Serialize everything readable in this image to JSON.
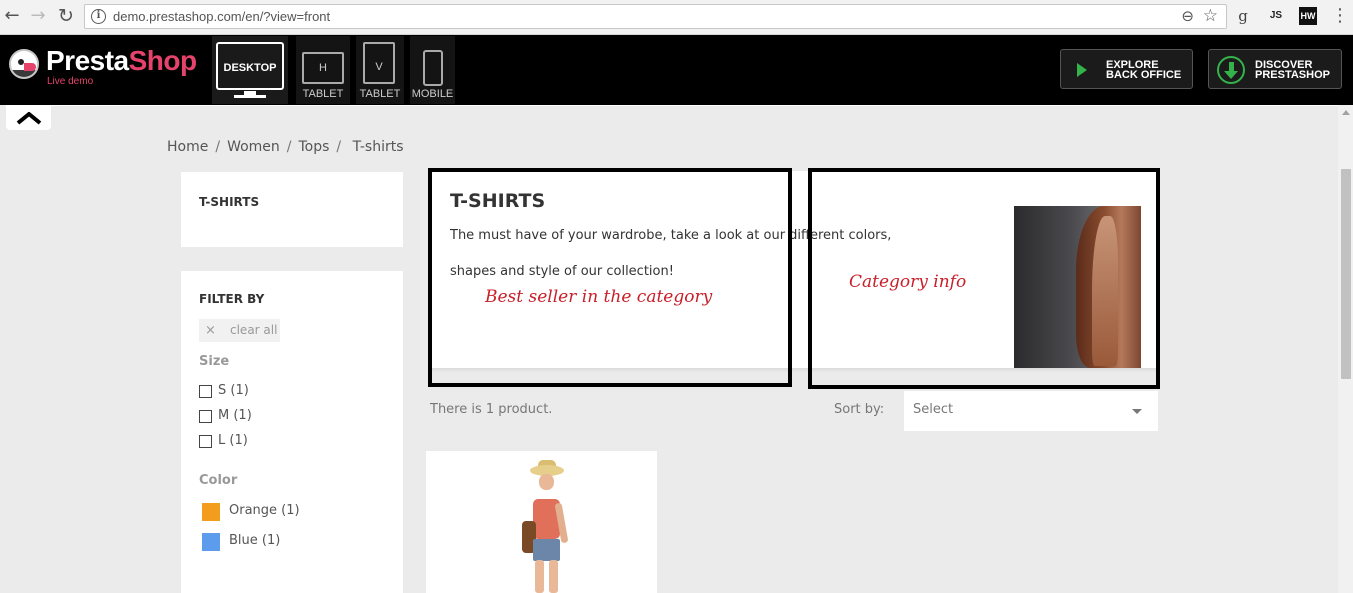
{
  "browser": {
    "url": "demo.prestashop.com/en/?view=front",
    "ext_g": "g",
    "ext_js": "JS",
    "ext_hw": "HW"
  },
  "topbar": {
    "logo_main": "Presta",
    "logo_accent": "Shop",
    "logo_sub": "Live demo",
    "devices": {
      "desktop": "DESKTOP",
      "tablet_h_letter": "H",
      "tablet_h": "TABLET",
      "tablet_v_letter": "V",
      "tablet_v": "TABLET",
      "mobile": "MOBILE"
    },
    "explore": {
      "line1": "EXPLORE",
      "line2": "BACK OFFICE"
    },
    "discover": {
      "line1": "DISCOVER",
      "line2": "PRESTASHOP"
    }
  },
  "breadcrumb": [
    "Home",
    "Women",
    "Tops",
    "T-shirts"
  ],
  "sidebar": {
    "category_title": "T-SHIRTS",
    "filter_heading": "FILTER BY",
    "clear_all": "clear all",
    "clear_icon": "×",
    "size": {
      "title": "Size",
      "options": [
        "S (1)",
        "M (1)",
        "L (1)"
      ]
    },
    "color": {
      "title": "Color",
      "options": [
        {
          "label": "Orange (1)",
          "hex": "#f39d1e"
        },
        {
          "label": "Blue (1)",
          "hex": "#5d9cec"
        }
      ]
    }
  },
  "category": {
    "title": "T-SHIRTS",
    "description": "The must have of your wardrobe, take a look at our different colors, shapes and style of our collection!"
  },
  "annotations": {
    "best_seller": "Best seller in the category",
    "category_info": "Category info"
  },
  "listing": {
    "count": "There is 1 product.",
    "sort_label": "Sort by:",
    "sort_value": "Select"
  },
  "colors": {
    "accent": "#e5436b",
    "green": "#33b34a",
    "annotation_red": "#c8202a"
  }
}
